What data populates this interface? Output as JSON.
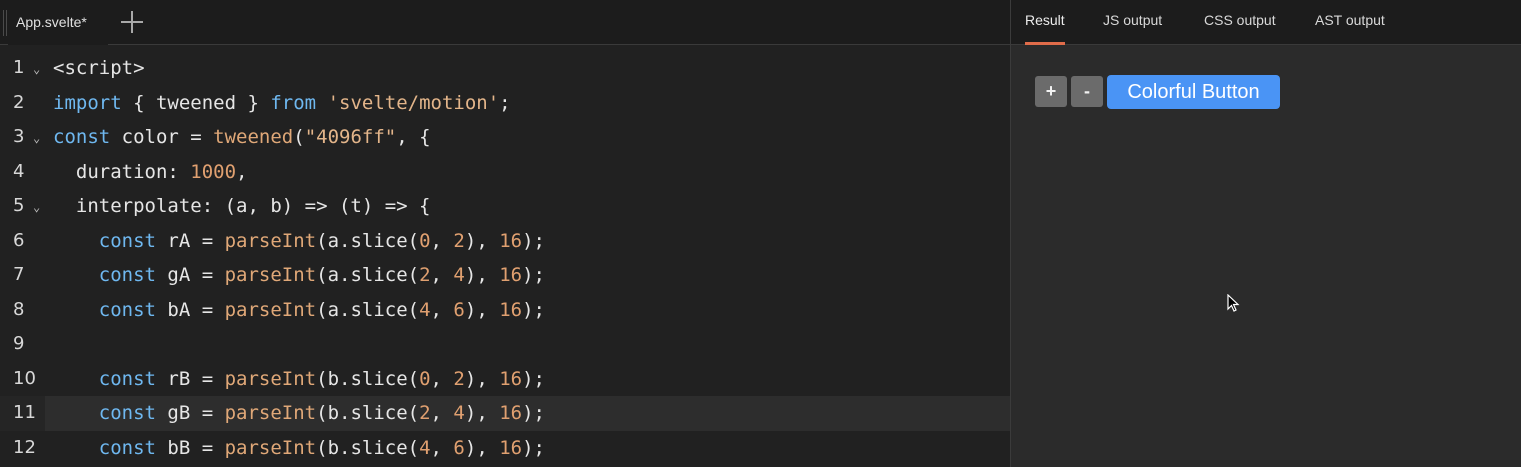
{
  "editor": {
    "file_tab": "App.svelte*",
    "lines": [
      {
        "n": "1",
        "fold": true,
        "tokens": [
          [
            "tag",
            "<script>"
          ]
        ]
      },
      {
        "n": "2",
        "fold": false,
        "tokens": [
          [
            "kw",
            "import"
          ],
          [
            "pl",
            " { tweened } "
          ],
          [
            "kw",
            "from"
          ],
          [
            "pl",
            " "
          ],
          [
            "str",
            "'svelte/motion'"
          ],
          [
            "pl",
            ";"
          ]
        ]
      },
      {
        "n": "3",
        "fold": true,
        "tokens": [
          [
            "kw",
            "const"
          ],
          [
            "pl",
            " color = "
          ],
          [
            "fn",
            "tweened"
          ],
          [
            "pl",
            "("
          ],
          [
            "str",
            "\"4096ff\""
          ],
          [
            "pl",
            ", {"
          ]
        ]
      },
      {
        "n": "4",
        "fold": false,
        "tokens": [
          [
            "pl",
            "  duration: "
          ],
          [
            "num",
            "1000"
          ],
          [
            "pl",
            ","
          ]
        ]
      },
      {
        "n": "5",
        "fold": true,
        "tokens": [
          [
            "pl",
            "  interpolate: (a, b) => (t) => {"
          ]
        ]
      },
      {
        "n": "6",
        "fold": false,
        "tokens": [
          [
            "pl",
            "    "
          ],
          [
            "kw",
            "const"
          ],
          [
            "pl",
            " rA = "
          ],
          [
            "fn",
            "parseInt"
          ],
          [
            "pl",
            "(a.slice("
          ],
          [
            "num",
            "0"
          ],
          [
            "pl",
            ", "
          ],
          [
            "num",
            "2"
          ],
          [
            "pl",
            "), "
          ],
          [
            "num",
            "16"
          ],
          [
            "pl",
            ");"
          ]
        ]
      },
      {
        "n": "7",
        "fold": false,
        "tokens": [
          [
            "pl",
            "    "
          ],
          [
            "kw",
            "const"
          ],
          [
            "pl",
            " gA = "
          ],
          [
            "fn",
            "parseInt"
          ],
          [
            "pl",
            "(a.slice("
          ],
          [
            "num",
            "2"
          ],
          [
            "pl",
            ", "
          ],
          [
            "num",
            "4"
          ],
          [
            "pl",
            "), "
          ],
          [
            "num",
            "16"
          ],
          [
            "pl",
            ");"
          ]
        ]
      },
      {
        "n": "8",
        "fold": false,
        "tokens": [
          [
            "pl",
            "    "
          ],
          [
            "kw",
            "const"
          ],
          [
            "pl",
            " bA = "
          ],
          [
            "fn",
            "parseInt"
          ],
          [
            "pl",
            "(a.slice("
          ],
          [
            "num",
            "4"
          ],
          [
            "pl",
            ", "
          ],
          [
            "num",
            "6"
          ],
          [
            "pl",
            "), "
          ],
          [
            "num",
            "16"
          ],
          [
            "pl",
            ");"
          ]
        ]
      },
      {
        "n": "9",
        "fold": false,
        "tokens": []
      },
      {
        "n": "10",
        "fold": false,
        "tokens": [
          [
            "pl",
            "    "
          ],
          [
            "kw",
            "const"
          ],
          [
            "pl",
            " rB = "
          ],
          [
            "fn",
            "parseInt"
          ],
          [
            "pl",
            "(b.slice("
          ],
          [
            "num",
            "0"
          ],
          [
            "pl",
            ", "
          ],
          [
            "num",
            "2"
          ],
          [
            "pl",
            "), "
          ],
          [
            "num",
            "16"
          ],
          [
            "pl",
            ");"
          ]
        ]
      },
      {
        "n": "11",
        "fold": false,
        "active": true,
        "tokens": [
          [
            "pl",
            "    "
          ],
          [
            "kw",
            "const"
          ],
          [
            "pl",
            " gB = "
          ],
          [
            "fn",
            "parseInt"
          ],
          [
            "pl",
            "(b.slice("
          ],
          [
            "num",
            "2"
          ],
          [
            "pl",
            ", "
          ],
          [
            "num",
            "4"
          ],
          [
            "pl",
            "), "
          ],
          [
            "num",
            "16"
          ],
          [
            "pl",
            ");"
          ]
        ]
      },
      {
        "n": "12",
        "fold": false,
        "tokens": [
          [
            "pl",
            "    "
          ],
          [
            "kw",
            "const"
          ],
          [
            "pl",
            " bB = "
          ],
          [
            "fn",
            "parseInt"
          ],
          [
            "pl",
            "(b.slice("
          ],
          [
            "num",
            "4"
          ],
          [
            "pl",
            ", "
          ],
          [
            "num",
            "6"
          ],
          [
            "pl",
            "), "
          ],
          [
            "num",
            "16"
          ],
          [
            "pl",
            ");"
          ]
        ]
      }
    ]
  },
  "output_tabs": [
    "Result",
    "JS output",
    "CSS output",
    "AST output"
  ],
  "preview": {
    "plus_label": "+",
    "minus_label": "-",
    "colorful_label": "Colorful Button"
  },
  "colors": {
    "accent_tab": "#e06c4a",
    "button_blue": "#4a94f5"
  }
}
